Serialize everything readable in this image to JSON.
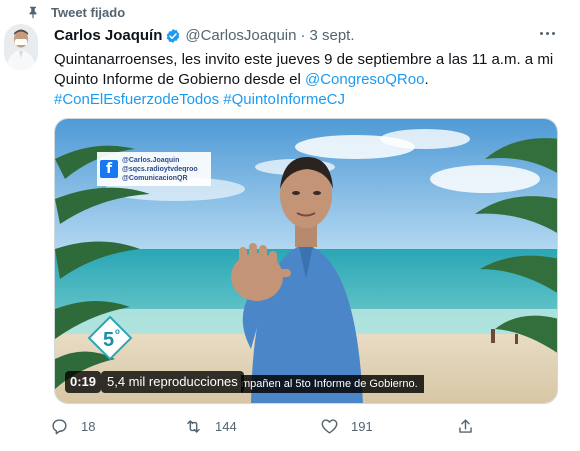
{
  "pinned": {
    "label": "Tweet fijado",
    "icon": "pin-icon"
  },
  "author": {
    "name": "Carlos Joaquín",
    "handle": "@CarlosJoaquin",
    "separator": "·",
    "time": "3 sept.",
    "verified_icon": "verified-badge-icon",
    "verified_color": "#1d9bf0"
  },
  "tweet": {
    "text_part1": "Quintanarroenses, les invito este jueves 9 de septiembre a las 11 a.m. a mi Quinto Informe de Gobierno desde el ",
    "mention": "@CongresoQRoo",
    "text_part2": ".",
    "hashtag1": "#ConElEsfuerzodeTodos",
    "hashtag2": "#QuintoInformeCJ",
    "link_color": "#1d9bf0"
  },
  "media": {
    "fb_icon_letter": "f",
    "social_lines": [
      "@Carlos.Joaquin",
      "@sqcs.radioytvdeqroo",
      "@ComunicacionQR"
    ],
    "logo_text": "5",
    "logo_superscript": "o",
    "caption": "mpañen al 5to Informe de Gobierno.",
    "duration": "0:19",
    "views": "5,4 mil reproducciones"
  },
  "actions": {
    "reply_count": "18",
    "retweet_count": "144",
    "like_count": "191"
  }
}
